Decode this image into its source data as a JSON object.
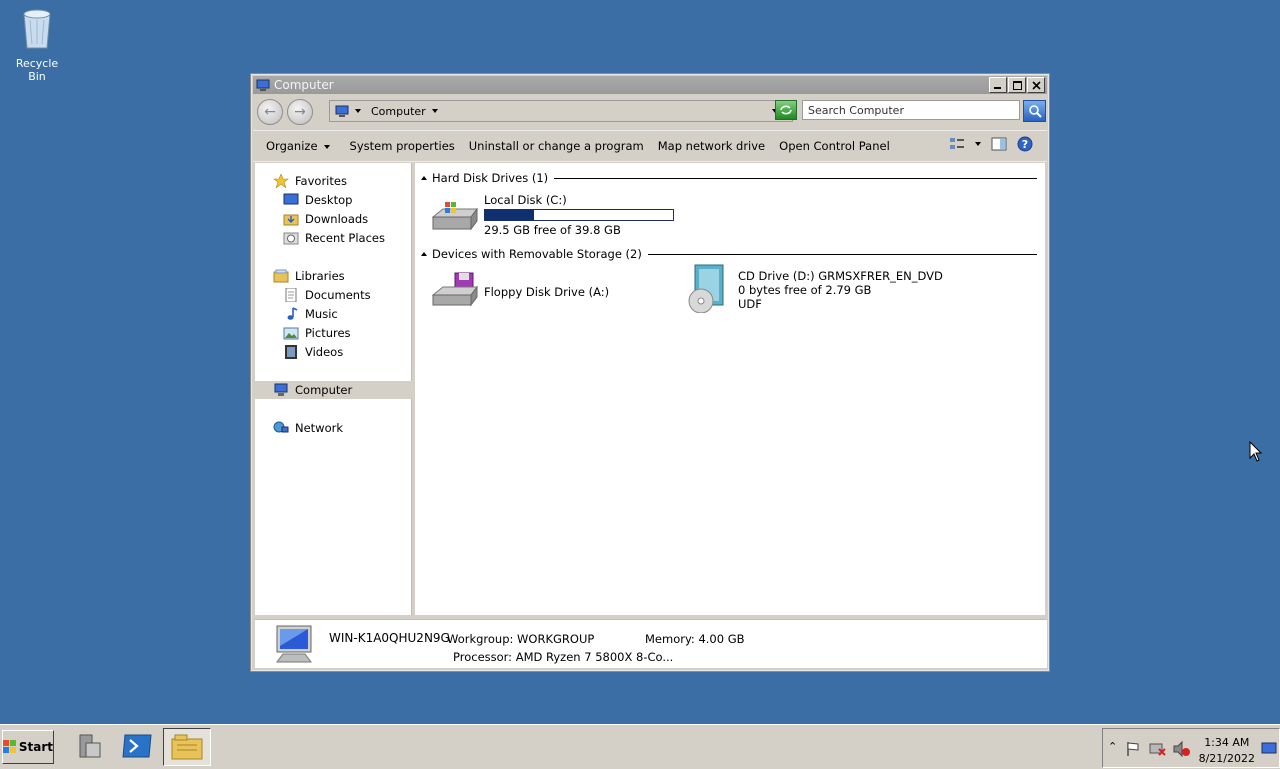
{
  "desktop": {
    "recycle_bin": "Recycle Bin"
  },
  "window": {
    "title": "Computer",
    "address": {
      "crumb": "Computer"
    },
    "search_placeholder": "Search Computer",
    "commands": [
      "Organize",
      "System properties",
      "Uninstall or change a program",
      "Map network drive",
      "Open Control Panel"
    ],
    "nav": {
      "favorites": "Favorites",
      "desktop": "Desktop",
      "downloads": "Downloads",
      "recent": "Recent Places",
      "libraries": "Libraries",
      "documents": "Documents",
      "music": "Music",
      "pictures": "Pictures",
      "videos": "Videos",
      "computer": "Computer",
      "network": "Network"
    },
    "groups": {
      "hdd": "Hard Disk Drives (1)",
      "removable": "Devices with Removable Storage (2)"
    },
    "drives": {
      "c": {
        "name": "Local Disk (C:)",
        "free": "29.5 GB free of 39.8 GB",
        "used_fraction": 0.26
      },
      "a": {
        "name": "Floppy Disk Drive (A:)"
      },
      "d": {
        "name": "CD Drive (D:) GRMSXFRER_EN_DVD",
        "free": "0 bytes free of 2.79 GB",
        "fs": "UDF"
      }
    },
    "details": {
      "computer_name": "WIN-K1A0QHU2N9G",
      "workgroup": "Workgroup: WORKGROUP",
      "memory": "Memory: 4.00 GB",
      "processor": "Processor: AMD Ryzen 7 5800X 8-Co..."
    }
  },
  "taskbar": {
    "start": "Start",
    "time": "1:34 AM",
    "date": "8/21/2022"
  }
}
